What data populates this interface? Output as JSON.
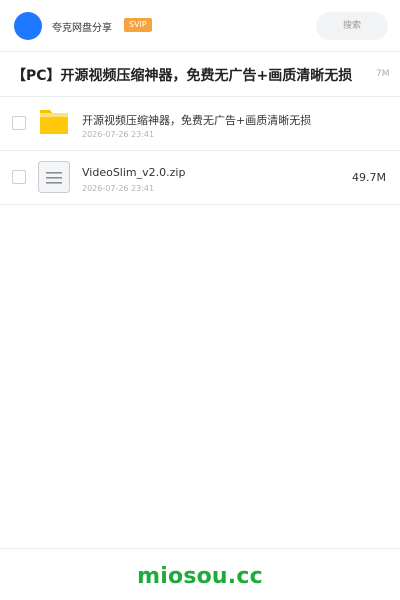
{
  "header": {
    "site_name": "夸克网盘分享",
    "badge": "SVIP",
    "search_placeholder": "搜索",
    "avatar_color": "#1e78ff"
  },
  "share": {
    "title": "【PC】开源视频压缩神器，免费无广告+画质清晰无损",
    "total_size": "7M"
  },
  "files": [
    {
      "name": "开源视频压缩神器，免费无广告+画质清晰无损",
      "date": "2026-07-26 23:41",
      "size": "",
      "icon": "folder-icon"
    },
    {
      "name": "VideoSlim_v2.0.zip",
      "date": "2026-07-26 23:41",
      "size": "49.7M",
      "icon": "zip-file-icon"
    }
  ],
  "footer": {
    "brand": "miosou.cc",
    "brand_color": "#1fab3a"
  }
}
